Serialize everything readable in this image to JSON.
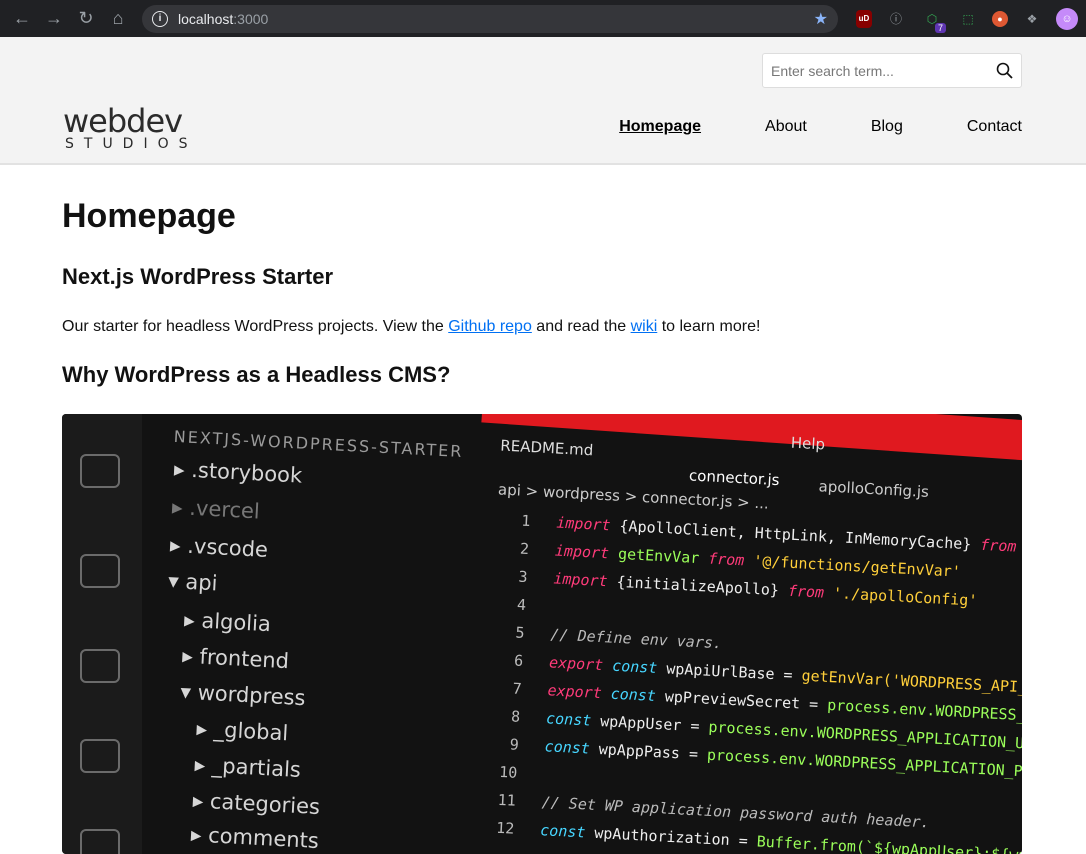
{
  "browser": {
    "url_host": "localhost",
    "url_port": ":3000",
    "ext_badge": "7",
    "ublock_label": "uD"
  },
  "search": {
    "placeholder": "Enter search term..."
  },
  "logo": {
    "word": "webdev",
    "sub": "STUDIOS"
  },
  "nav": [
    {
      "label": "Homepage",
      "active": true
    },
    {
      "label": "About"
    },
    {
      "label": "Blog"
    },
    {
      "label": "Contact"
    }
  ],
  "page": {
    "title": "Homepage",
    "subtitle": "Next.js WordPress Starter",
    "intro_before": "Our starter for headless WordPress projects. View the ",
    "intro_link1": "Github repo",
    "intro_middle": " and read the ",
    "intro_link2": "wiki",
    "intro_after": " to learn more!",
    "section_heading": "Why WordPress as a Headless CMS?"
  },
  "hero": {
    "tree_header": "NEXTJS-WORDPRESS-STARTER",
    "tree": [
      ".storybook",
      ".vercel",
      ".vscode",
      "api",
      "algolia",
      "frontend",
      "wordpress",
      "_global",
      "_partials",
      "categories",
      "comments"
    ],
    "tabs": [
      "README.md",
      "connector.js",
      "apolloConfig.js",
      "Help"
    ],
    "breadcrumb": "api > wordpress > connector.js > ...",
    "code": [
      {
        "n": "1",
        "text": "import {ApolloClient, HttpLink, InMemoryCache} from '@apollo/cl"
      },
      {
        "n": "2",
        "text": "import getEnvVar from '@/functions/getEnvVar'"
      },
      {
        "n": "3",
        "text": "import {initializeApollo} from './apolloConfig'"
      },
      {
        "n": "4",
        "text": ""
      },
      {
        "n": "5",
        "text": "// Define env vars."
      },
      {
        "n": "6",
        "text": "export const wpApiUrlBase = getEnvVar('WORDPRESS_API_URL')"
      },
      {
        "n": "7",
        "text": "export const wpPreviewSecret = process.env.WORDPRESS_PREVIEW_SECRE"
      },
      {
        "n": "8",
        "text": "const wpAppUser = process.env.WORDPRESS_APPLICATION_USERNAME"
      },
      {
        "n": "9",
        "text": "const wpAppPass = process.env.WORDPRESS_APPLICATION_PASSWORD"
      },
      {
        "n": "10",
        "text": ""
      },
      {
        "n": "11",
        "text": "// Set WP application password auth header."
      },
      {
        "n": "12",
        "text": "const wpAuthorization = Buffer.from(`${wpAppUser}:${wpAppPass}`).toS"
      }
    ]
  }
}
